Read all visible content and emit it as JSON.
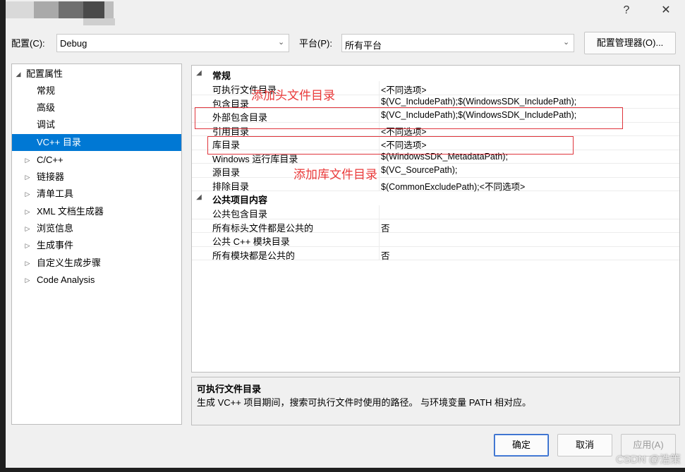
{
  "titlebar": {
    "help": "?",
    "close": "✕"
  },
  "config": {
    "label": "配置(C):",
    "value": "Debug"
  },
  "platform": {
    "label": "平台(P):",
    "value": "所有平台"
  },
  "config_manager_button": "配置管理器(O)...",
  "tree": [
    {
      "label": "配置属性",
      "expanded": true,
      "level": 0
    },
    {
      "label": "常规",
      "level": 1
    },
    {
      "label": "高级",
      "level": 1
    },
    {
      "label": "调试",
      "level": 1
    },
    {
      "label": "VC++ 目录",
      "level": 1,
      "selected": true
    },
    {
      "label": "C/C++",
      "level": 1,
      "collapsed": true
    },
    {
      "label": "链接器",
      "level": 1,
      "collapsed": true
    },
    {
      "label": "清单工具",
      "level": 1,
      "collapsed": true
    },
    {
      "label": "XML 文档生成器",
      "level": 1,
      "collapsed": true
    },
    {
      "label": "浏览信息",
      "level": 1,
      "collapsed": true
    },
    {
      "label": "生成事件",
      "level": 1,
      "collapsed": true
    },
    {
      "label": "自定义生成步骤",
      "level": 1,
      "collapsed": true
    },
    {
      "label": "Code Analysis",
      "level": 1,
      "collapsed": true
    }
  ],
  "categories": [
    {
      "name": "常规",
      "rows": [
        {
          "name": "可执行文件目录",
          "value": "<不同选项>"
        },
        {
          "name": "包含目录",
          "value": "$(VC_IncludePath);$(WindowsSDK_IncludePath);"
        },
        {
          "name": "外部包含目录",
          "value": "$(VC_IncludePath);$(WindowsSDK_IncludePath);"
        },
        {
          "name": "引用目录",
          "value": "<不同选项>"
        },
        {
          "name": "库目录",
          "value": "<不同选项>"
        },
        {
          "name": "Windows 运行库目录",
          "value": "$(WindowsSDK_MetadataPath);"
        },
        {
          "name": "源目录",
          "value": "$(VC_SourcePath);"
        },
        {
          "name": "排除目录",
          "value": "$(CommonExcludePath);<不同选项>"
        }
      ]
    },
    {
      "name": "公共项目内容",
      "rows": [
        {
          "name": "公共包含目录",
          "value": ""
        },
        {
          "name": "所有标头文件都是公共的",
          "value": "否"
        },
        {
          "name": "公共 C++ 模块目录",
          "value": ""
        },
        {
          "name": "所有模块都是公共的",
          "value": "否"
        }
      ]
    }
  ],
  "annotations": {
    "header_dir": "添加头文件目录",
    "lib_dir": "添加库文件目录"
  },
  "description": {
    "title": "可执行文件目录",
    "text": "生成 VC++ 项目期间，搜索可执行文件时使用的路径。 与环境变量 PATH 相对应。"
  },
  "buttons": {
    "ok": "确定",
    "cancel": "取消",
    "apply": "应用(A)"
  },
  "watermark": "CSDN @浩策",
  "colors": {
    "selection": "#0078d4",
    "annotation": "#ea3a3a"
  }
}
